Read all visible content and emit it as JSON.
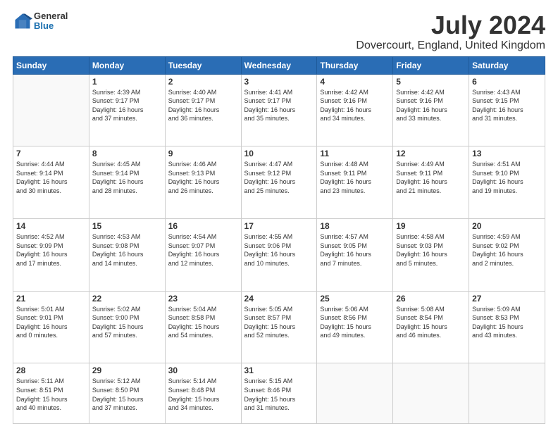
{
  "header": {
    "logo_general": "General",
    "logo_blue": "Blue",
    "title": "July 2024",
    "subtitle": "Dovercourt, England, United Kingdom"
  },
  "days_of_week": [
    "Sunday",
    "Monday",
    "Tuesday",
    "Wednesday",
    "Thursday",
    "Friday",
    "Saturday"
  ],
  "weeks": [
    [
      {
        "day": "",
        "info": ""
      },
      {
        "day": "1",
        "info": "Sunrise: 4:39 AM\nSunset: 9:17 PM\nDaylight: 16 hours\nand 37 minutes."
      },
      {
        "day": "2",
        "info": "Sunrise: 4:40 AM\nSunset: 9:17 PM\nDaylight: 16 hours\nand 36 minutes."
      },
      {
        "day": "3",
        "info": "Sunrise: 4:41 AM\nSunset: 9:17 PM\nDaylight: 16 hours\nand 35 minutes."
      },
      {
        "day": "4",
        "info": "Sunrise: 4:42 AM\nSunset: 9:16 PM\nDaylight: 16 hours\nand 34 minutes."
      },
      {
        "day": "5",
        "info": "Sunrise: 4:42 AM\nSunset: 9:16 PM\nDaylight: 16 hours\nand 33 minutes."
      },
      {
        "day": "6",
        "info": "Sunrise: 4:43 AM\nSunset: 9:15 PM\nDaylight: 16 hours\nand 31 minutes."
      }
    ],
    [
      {
        "day": "7",
        "info": "Sunrise: 4:44 AM\nSunset: 9:14 PM\nDaylight: 16 hours\nand 30 minutes."
      },
      {
        "day": "8",
        "info": "Sunrise: 4:45 AM\nSunset: 9:14 PM\nDaylight: 16 hours\nand 28 minutes."
      },
      {
        "day": "9",
        "info": "Sunrise: 4:46 AM\nSunset: 9:13 PM\nDaylight: 16 hours\nand 26 minutes."
      },
      {
        "day": "10",
        "info": "Sunrise: 4:47 AM\nSunset: 9:12 PM\nDaylight: 16 hours\nand 25 minutes."
      },
      {
        "day": "11",
        "info": "Sunrise: 4:48 AM\nSunset: 9:11 PM\nDaylight: 16 hours\nand 23 minutes."
      },
      {
        "day": "12",
        "info": "Sunrise: 4:49 AM\nSunset: 9:11 PM\nDaylight: 16 hours\nand 21 minutes."
      },
      {
        "day": "13",
        "info": "Sunrise: 4:51 AM\nSunset: 9:10 PM\nDaylight: 16 hours\nand 19 minutes."
      }
    ],
    [
      {
        "day": "14",
        "info": "Sunrise: 4:52 AM\nSunset: 9:09 PM\nDaylight: 16 hours\nand 17 minutes."
      },
      {
        "day": "15",
        "info": "Sunrise: 4:53 AM\nSunset: 9:08 PM\nDaylight: 16 hours\nand 14 minutes."
      },
      {
        "day": "16",
        "info": "Sunrise: 4:54 AM\nSunset: 9:07 PM\nDaylight: 16 hours\nand 12 minutes."
      },
      {
        "day": "17",
        "info": "Sunrise: 4:55 AM\nSunset: 9:06 PM\nDaylight: 16 hours\nand 10 minutes."
      },
      {
        "day": "18",
        "info": "Sunrise: 4:57 AM\nSunset: 9:05 PM\nDaylight: 16 hours\nand 7 minutes."
      },
      {
        "day": "19",
        "info": "Sunrise: 4:58 AM\nSunset: 9:03 PM\nDaylight: 16 hours\nand 5 minutes."
      },
      {
        "day": "20",
        "info": "Sunrise: 4:59 AM\nSunset: 9:02 PM\nDaylight: 16 hours\nand 2 minutes."
      }
    ],
    [
      {
        "day": "21",
        "info": "Sunrise: 5:01 AM\nSunset: 9:01 PM\nDaylight: 16 hours\nand 0 minutes."
      },
      {
        "day": "22",
        "info": "Sunrise: 5:02 AM\nSunset: 9:00 PM\nDaylight: 15 hours\nand 57 minutes."
      },
      {
        "day": "23",
        "info": "Sunrise: 5:04 AM\nSunset: 8:58 PM\nDaylight: 15 hours\nand 54 minutes."
      },
      {
        "day": "24",
        "info": "Sunrise: 5:05 AM\nSunset: 8:57 PM\nDaylight: 15 hours\nand 52 minutes."
      },
      {
        "day": "25",
        "info": "Sunrise: 5:06 AM\nSunset: 8:56 PM\nDaylight: 15 hours\nand 49 minutes."
      },
      {
        "day": "26",
        "info": "Sunrise: 5:08 AM\nSunset: 8:54 PM\nDaylight: 15 hours\nand 46 minutes."
      },
      {
        "day": "27",
        "info": "Sunrise: 5:09 AM\nSunset: 8:53 PM\nDaylight: 15 hours\nand 43 minutes."
      }
    ],
    [
      {
        "day": "28",
        "info": "Sunrise: 5:11 AM\nSunset: 8:51 PM\nDaylight: 15 hours\nand 40 minutes."
      },
      {
        "day": "29",
        "info": "Sunrise: 5:12 AM\nSunset: 8:50 PM\nDaylight: 15 hours\nand 37 minutes."
      },
      {
        "day": "30",
        "info": "Sunrise: 5:14 AM\nSunset: 8:48 PM\nDaylight: 15 hours\nand 34 minutes."
      },
      {
        "day": "31",
        "info": "Sunrise: 5:15 AM\nSunset: 8:46 PM\nDaylight: 15 hours\nand 31 minutes."
      },
      {
        "day": "",
        "info": ""
      },
      {
        "day": "",
        "info": ""
      },
      {
        "day": "",
        "info": ""
      }
    ]
  ]
}
